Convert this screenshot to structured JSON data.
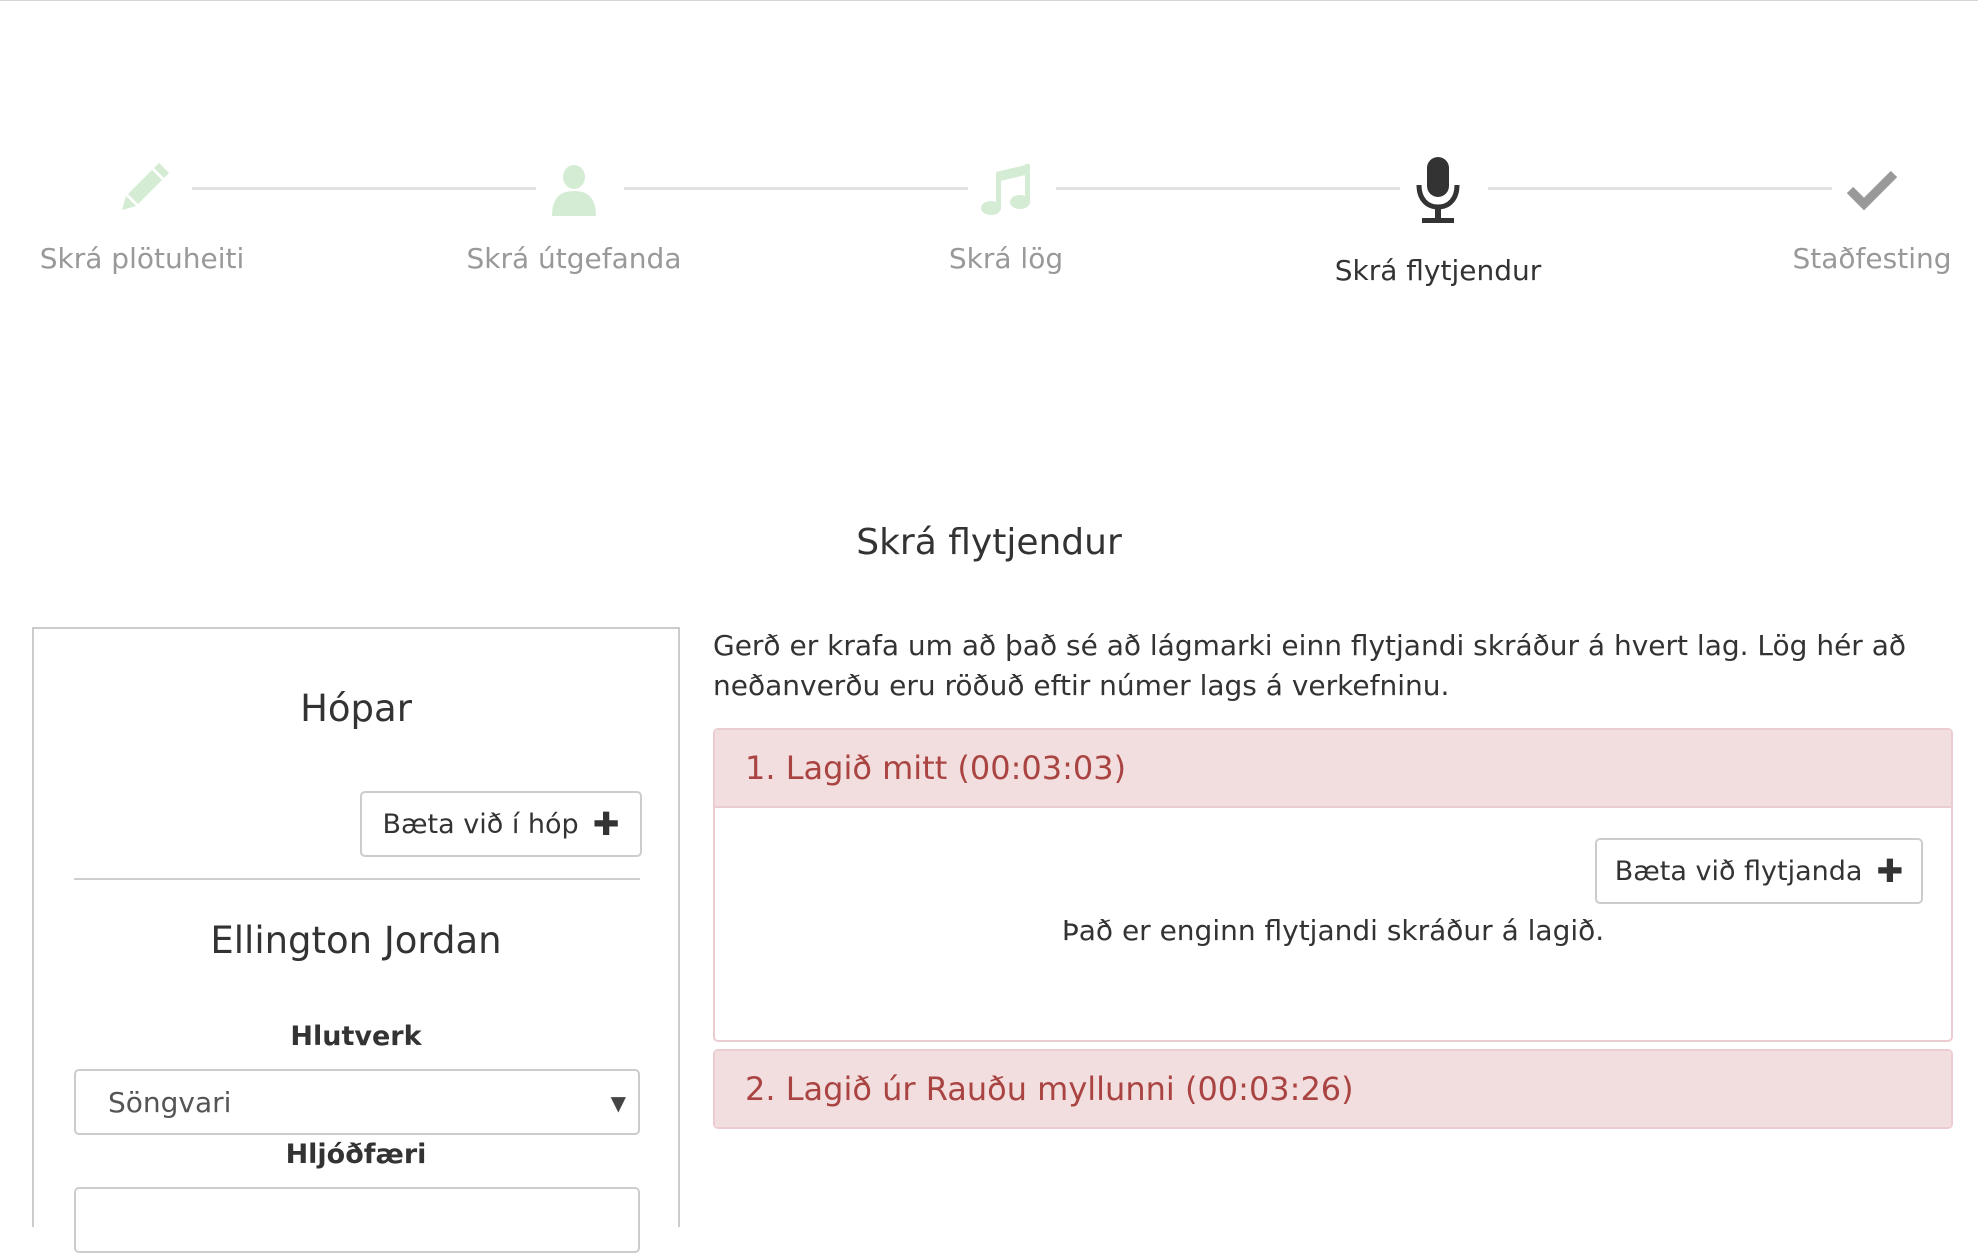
{
  "stepper": {
    "steps": [
      {
        "label": "Skrá plötuheiti",
        "icon": "pencil-icon",
        "state": "done"
      },
      {
        "label": "Skrá útgefanda",
        "icon": "user-icon",
        "state": "done"
      },
      {
        "label": "Skrá lög",
        "icon": "music-icon",
        "state": "done"
      },
      {
        "label": "Skrá flytjendur",
        "icon": "microphone-icon",
        "state": "active"
      },
      {
        "label": "Staðfesting",
        "icon": "check-icon",
        "state": "pending"
      }
    ],
    "colors": {
      "done": "#d4ecd4",
      "active": "#333333",
      "pending": "#999999"
    }
  },
  "page": {
    "title": "Skrá flytjendur"
  },
  "groups": {
    "title": "Hópar",
    "add_button_label": "Bæta við í hóp",
    "member": {
      "name": "Ellington Jordan",
      "role_label": "Hlutverk",
      "role_value": "Söngvari",
      "instrument_label": "Hljóðfæri",
      "instrument_value": ""
    }
  },
  "main": {
    "info_text": "Gerð er krafa um að það sé að lágmarki einn flytjandi skráður á hvert lag. Lög hér að neðanverðu eru röðuð eftir númer lags á verkefninu.",
    "songs": [
      {
        "title": "1. Lagið mitt (00:03:03)",
        "add_performer_label": "Bæta við flytjanda",
        "empty_text": "Það er enginn flytjandi skráður á lagið.",
        "expanded": true
      },
      {
        "title": "2. Lagið úr Rauðu myllunni (00:03:26)",
        "expanded": false
      }
    ],
    "colors": {
      "song_header_bg": "#f2dede",
      "song_header_text": "#a94442",
      "song_border": "#ebccd1"
    }
  }
}
